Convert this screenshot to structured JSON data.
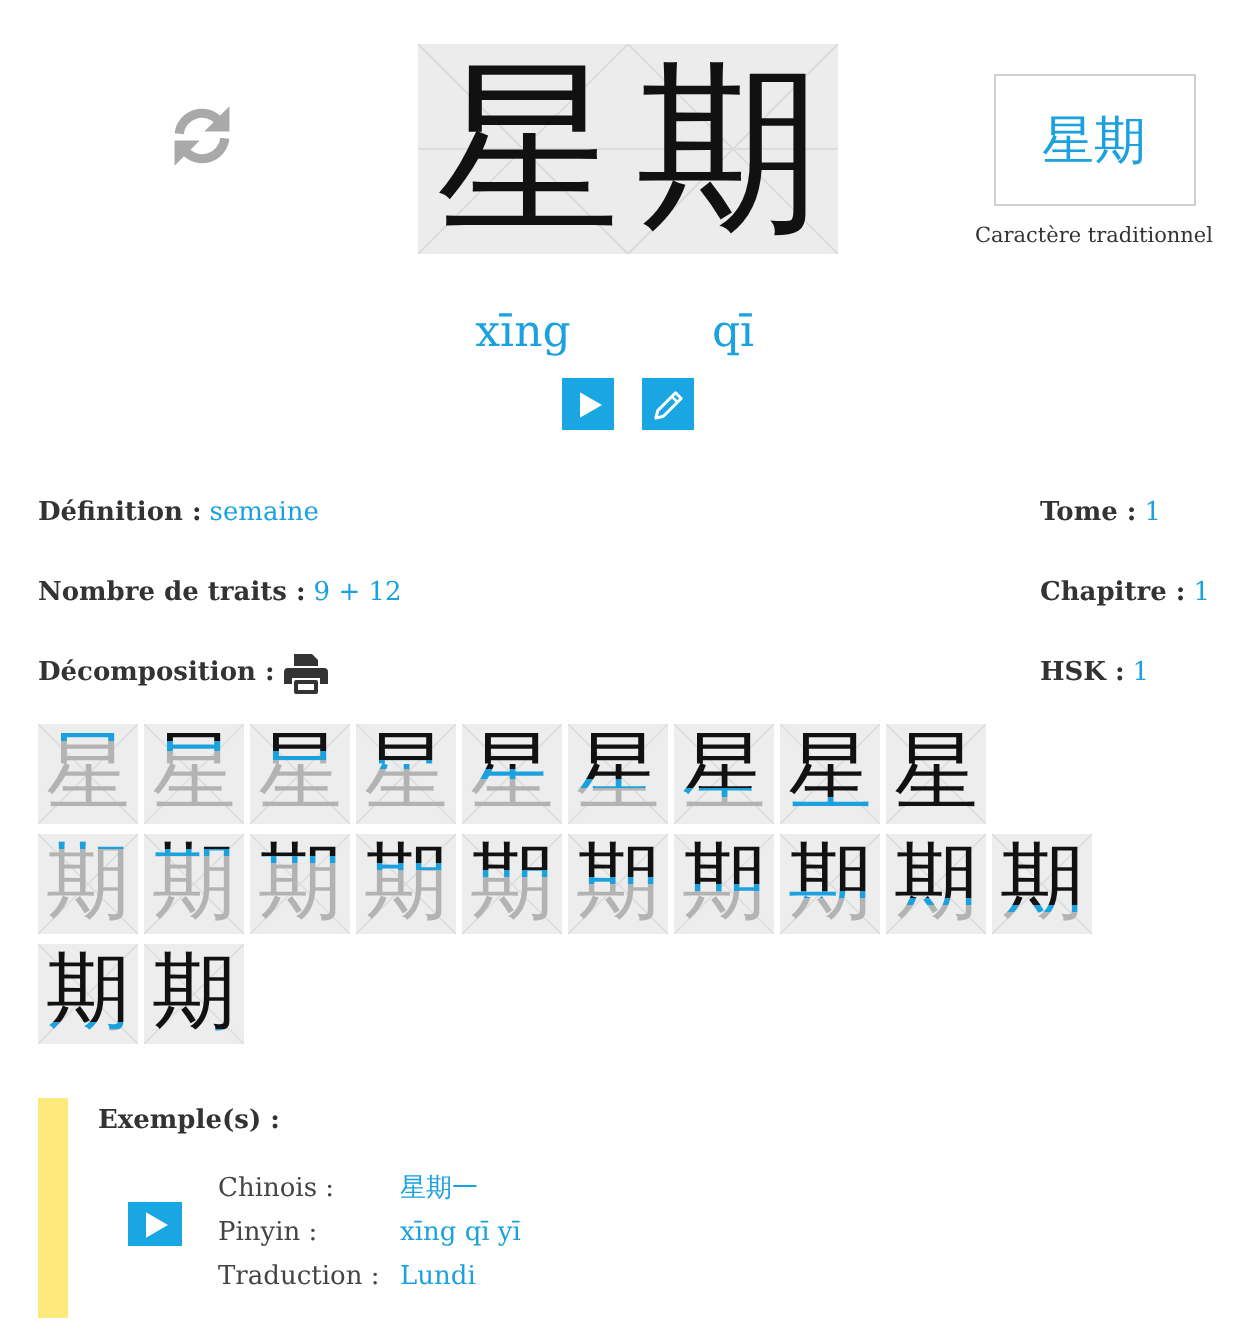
{
  "character": {
    "hanzi": "星期",
    "pinyin": [
      "xīng",
      "qī"
    ],
    "traditional": "星期",
    "traditional_caption": "Caractère traditionnel"
  },
  "details": {
    "left": [
      {
        "kind": "text",
        "label": "Définition :",
        "value": "semaine"
      },
      {
        "kind": "text",
        "label": "Nombre de traits :",
        "value": "9 + 12"
      },
      {
        "kind": "print",
        "label": "Décomposition :"
      }
    ],
    "right": [
      {
        "kind": "text",
        "label": "Tome :",
        "value": "1"
      },
      {
        "kind": "text",
        "label": "Chapitre :",
        "value": "1"
      },
      {
        "kind": "text",
        "label": "HSK :",
        "value": "1"
      }
    ]
  },
  "stroke_order": [
    {
      "tiles": [
        {
          "character": "星"
        },
        {
          "character": "星"
        },
        {
          "character": "星"
        },
        {
          "character": "星"
        },
        {
          "character": "星"
        },
        {
          "character": "星"
        },
        {
          "character": "星"
        },
        {
          "character": "星"
        },
        {
          "character": "星"
        }
      ]
    },
    {
      "tiles": [
        {
          "character": "期"
        },
        {
          "character": "期"
        },
        {
          "character": "期"
        },
        {
          "character": "期"
        },
        {
          "character": "期"
        },
        {
          "character": "期"
        },
        {
          "character": "期"
        },
        {
          "character": "期"
        },
        {
          "character": "期"
        },
        {
          "character": "期"
        },
        {
          "character": "期"
        },
        {
          "character": "期"
        }
      ]
    }
  ],
  "example": {
    "title": "Exemple(s) :",
    "rows": [
      {
        "label": "Chinois :",
        "value": "星期一"
      },
      {
        "label": "Pinyin :",
        "value": "xīng qī yī"
      },
      {
        "label": "Traduction :",
        "value": "Lundi"
      }
    ]
  }
}
